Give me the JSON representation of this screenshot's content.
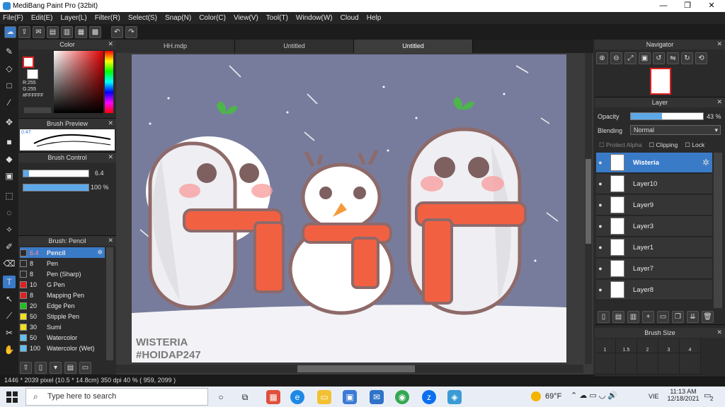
{
  "window": {
    "title": "MediBang Paint Pro (32bit)",
    "minimize": "—",
    "maximize": "❐",
    "close": "✕"
  },
  "menu": [
    "File(F)",
    "Edit(E)",
    "Layer(L)",
    "Filter(R)",
    "Select(S)",
    "Snap(N)",
    "Color(C)",
    "View(V)",
    "Tool(T)",
    "Window(W)",
    "Cloud",
    "Help"
  ],
  "color_panel": {
    "title": "Color",
    "r_label": "R:255",
    "g_label": "G:255",
    "hex": "#FFFFFF",
    "primary_color": "#e02020",
    "secondary_color": "#ffffff"
  },
  "brush_preview": {
    "title": "Brush Preview",
    "size_label": "0.47"
  },
  "brush_control": {
    "title": "Brush Control",
    "size_value": "6.4",
    "opacity_value": "100 %"
  },
  "brush_list": {
    "title": "Brush: Pencil",
    "items": [
      {
        "size": "6.4",
        "name": "Pencil",
        "color": "#2b2b2b",
        "selected": true
      },
      {
        "size": "8",
        "name": "Pen",
        "color": "#2b2b2b"
      },
      {
        "size": "8",
        "name": "Pen (Sharp)",
        "color": "#2b2b2b"
      },
      {
        "size": "10",
        "name": "G Pen",
        "color": "#e02020"
      },
      {
        "size": "8",
        "name": "Mapping Pen",
        "color": "#e02020"
      },
      {
        "size": "20",
        "name": "Edge Pen",
        "color": "#20c020"
      },
      {
        "size": "50",
        "name": "Stipple Pen",
        "color": "#f0e020"
      },
      {
        "size": "30",
        "name": "Sumi",
        "color": "#f0e020"
      },
      {
        "size": "50",
        "name": "Watercolor",
        "color": "#60c0f0"
      },
      {
        "size": "100",
        "name": "Watercolor (Wet)",
        "color": "#60c0f0"
      }
    ]
  },
  "doc_tabs": [
    {
      "label": "HH.mdp",
      "active": false
    },
    {
      "label": "Untitled",
      "active": false
    },
    {
      "label": "Untitled",
      "active": true
    }
  ],
  "artwork": {
    "signature_line1": "WISTERIA",
    "signature_line2": "#HOIDAP247"
  },
  "navigator": {
    "title": "Navigator"
  },
  "layer_panel": {
    "title": "Layer",
    "opacity_label": "Opacity",
    "opacity_value": "43 %",
    "opacity_fraction": 0.43,
    "blending_label": "Blending",
    "blending_value": "Normal",
    "protect_alpha": "Protect Alpha",
    "clipping": "Clipping",
    "lock": "Lock",
    "layers": [
      {
        "name": "Wisteria",
        "selected": true
      },
      {
        "name": "Layer10"
      },
      {
        "name": "Layer9"
      },
      {
        "name": "Layer3"
      },
      {
        "name": "Layer1"
      },
      {
        "name": "Layer7"
      },
      {
        "name": "Layer8"
      }
    ]
  },
  "brush_size": {
    "title": "Brush Size",
    "sizes": [
      "1",
      "1.5",
      "2",
      "3",
      "4"
    ]
  },
  "status": {
    "text": "1446 * 2039 pixel  (10.5 * 14.8cm)  350 dpi  40 %  ( 959, 2099 )"
  },
  "taskbar": {
    "search_placeholder": "Type here to search",
    "weather": "69°F",
    "lang": "VIE",
    "time": "11:13 AM",
    "date": "12/18/2021",
    "notif_count": "2"
  }
}
